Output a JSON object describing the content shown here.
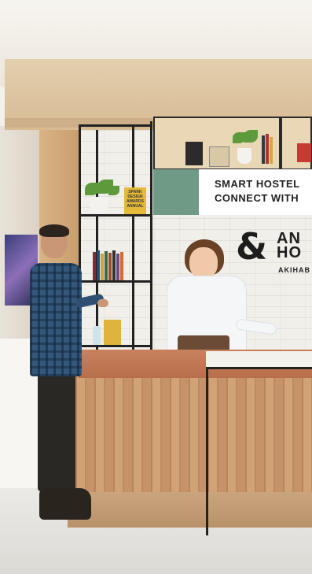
{
  "scene": {
    "type": "hotel-lobby-reception-rendering",
    "colors": {
      "counter_wood": "#c6926a",
      "counter_top": "#c9825e",
      "sign_green": "#6f9b86",
      "shelf_frame": "#222222",
      "brick_wall": "#f1efea"
    }
  },
  "sign": {
    "line1": "SMART HOSTEL",
    "line2": "CONNECT WITH"
  },
  "logo": {
    "ampersand": "&",
    "word1": "AN",
    "word2": "HO",
    "sub": "AKIHAB"
  },
  "book": {
    "text": "SPARK DESIGN AWARDS ANNUAL"
  }
}
